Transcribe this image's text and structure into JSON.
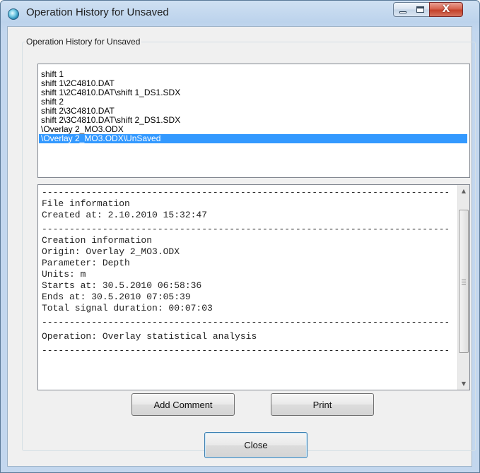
{
  "window": {
    "title": "Operation History for Unsaved",
    "close_glyph": "X"
  },
  "group": {
    "label": "Operation History for Unsaved"
  },
  "history_list": {
    "items": [
      "shift 1",
      "shift 1\\2C4810.DAT",
      "shift 1\\2C4810.DAT\\shift 1_DS1.SDX",
      "shift 2",
      "shift 2\\3C4810.DAT",
      "shift 2\\3C4810.DAT\\shift 2_DS1.SDX",
      "\\Overlay 2_MO3.ODX",
      "\\Overlay 2_MO3.ODX\\UnSaved"
    ],
    "selected_index": 7
  },
  "details": {
    "lines": [
      "----------------------------------------------------------------------------------------",
      "File information",
      "Created at: 2.10.2010 15:32:47",
      "----------------------------------------------------------------------------------------",
      "Creation information",
      "Origin: Overlay 2_MO3.ODX",
      "Parameter: Depth",
      "Units: m",
      "Starts at: 30.5.2010 06:58:36",
      "Ends at: 30.5.2010 07:05:39",
      "Total signal duration: 00:07:03",
      "----------------------------------------------------------------------------------------",
      "Operation: Overlay statistical analysis",
      "----------------------------------------------------------------------------------------"
    ],
    "scroll_up_glyph": "▲",
    "scroll_down_glyph": "▼"
  },
  "buttons": {
    "add_comment": "Add Comment",
    "print": "Print",
    "close": "Close"
  },
  "colors": {
    "selection": "#3399ff",
    "title_close": "#c4412a"
  }
}
